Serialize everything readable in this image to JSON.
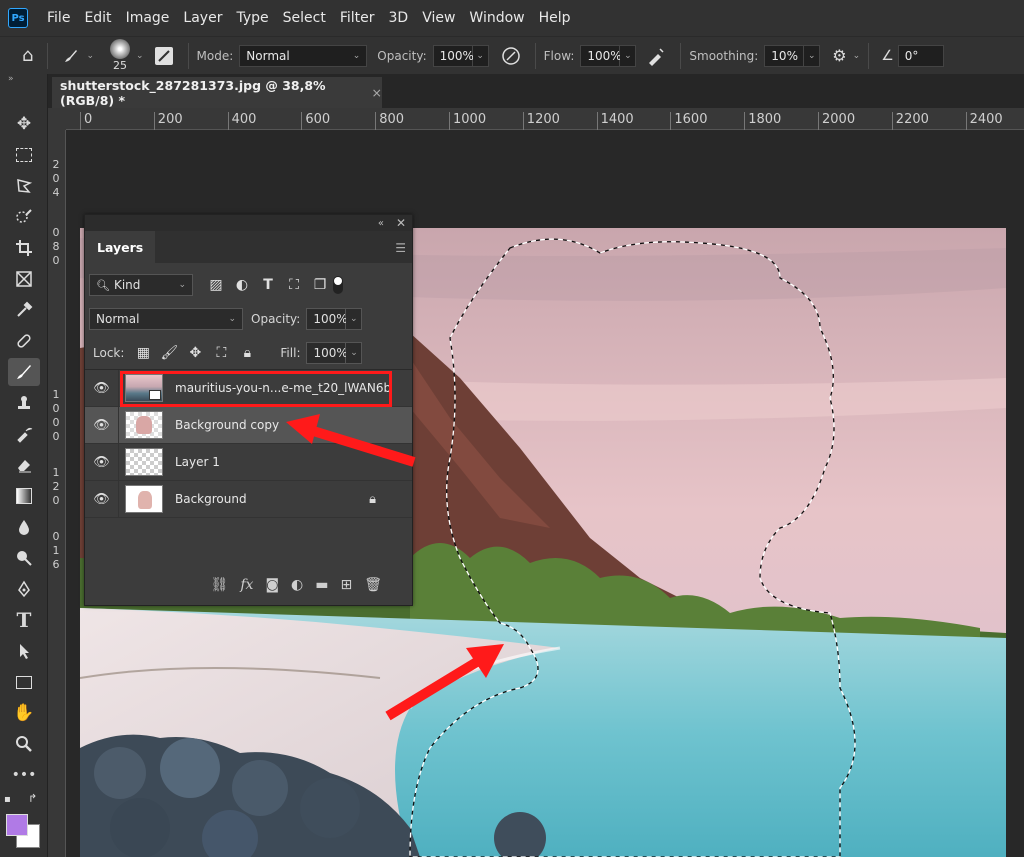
{
  "app": {
    "logo": "Ps"
  },
  "menu": [
    "File",
    "Edit",
    "Image",
    "Layer",
    "Type",
    "Select",
    "Filter",
    "3D",
    "View",
    "Window",
    "Help"
  ],
  "options": {
    "brush_size": "25",
    "mode_label": "Mode:",
    "mode_value": "Normal",
    "opacity_label": "Opacity:",
    "opacity_value": "100%",
    "flow_label": "Flow:",
    "flow_value": "100%",
    "smoothing_label": "Smoothing:",
    "smoothing_value": "10%",
    "angle_value": "0°"
  },
  "document": {
    "tab_title": "shutterstock_287281373.jpg @ 38,8% (RGB/8) *",
    "close": "×"
  },
  "ruler_h": [
    "0",
    "200",
    "400",
    "600",
    "800",
    "1000",
    "1200",
    "1400",
    "1600",
    "1800",
    "2000",
    "2200",
    "2400"
  ],
  "ruler_v": [
    "2",
    "0",
    "4",
    "0",
    "8",
    "0",
    "1",
    "0",
    "0",
    "0",
    "1",
    "2",
    "0",
    "0",
    "1",
    "6"
  ],
  "layers_panel": {
    "tab": "Layers",
    "kind_label": "Kind",
    "blend_mode": "Normal",
    "opacity_label": "Opacity:",
    "opacity_value": "100%",
    "lock_label": "Lock:",
    "fill_label": "Fill:",
    "fill_value": "100%",
    "layers": [
      {
        "name": "mauritius-you-n...e-me_t20_lWAN6b"
      },
      {
        "name": "Background copy"
      },
      {
        "name": "Layer 1"
      },
      {
        "name": "Background"
      }
    ]
  },
  "colors": {
    "foreground": "#b07ae6",
    "background": "#ffffff",
    "highlight": "#ff1a1a"
  }
}
